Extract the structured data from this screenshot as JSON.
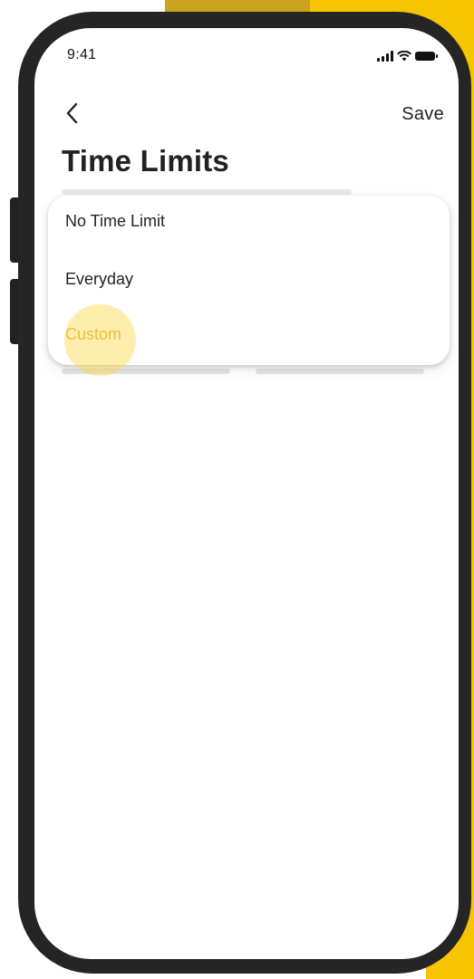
{
  "status_bar": {
    "time": "9:41",
    "icons": [
      "cellular-signal-icon",
      "wifi-icon",
      "battery-icon"
    ]
  },
  "nav": {
    "back_icon": "chevron-left-icon",
    "save_label": "Save"
  },
  "page": {
    "title": "Time Limits"
  },
  "dropdown": {
    "options": [
      {
        "label": "No Time Limit"
      },
      {
        "label": "Everyday"
      },
      {
        "label": "Custom"
      }
    ],
    "highlighted_option": "Custom"
  },
  "colors": {
    "accent_yellow": "#f7c400",
    "accent_dark_yellow": "#c9a21e",
    "phone_frame": "#252525",
    "tap_highlight": "#ffd64a",
    "highlighted_text": "#cfae3a"
  }
}
